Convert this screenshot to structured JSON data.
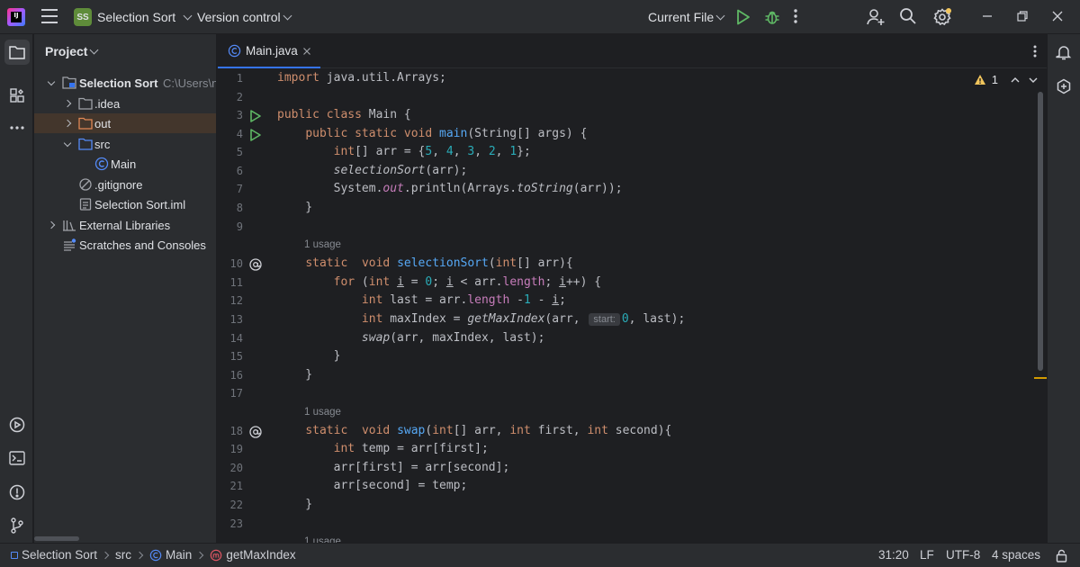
{
  "titlebar": {
    "logo_text": "IJ",
    "project_badge": "SS",
    "project_name": "Selection Sort",
    "vcs_label": "Version control",
    "run_config": "Current File"
  },
  "project_panel": {
    "title": "Project",
    "tree": [
      {
        "label": "Selection Sort",
        "path": "C:\\Users\\n",
        "icon": "module-folder-icon",
        "expanded": true,
        "bold": true
      },
      {
        "label": ".idea",
        "icon": "folder-icon",
        "expanded": false
      },
      {
        "label": "out",
        "icon": "folder-orange-icon",
        "expanded": false,
        "selected": true
      },
      {
        "label": "src",
        "icon": "source-folder-icon",
        "expanded": true
      },
      {
        "label": "Main",
        "icon": "java-class-icon"
      },
      {
        "label": ".gitignore",
        "icon": "ignored-file-icon"
      },
      {
        "label": "Selection Sort.iml",
        "icon": "iml-file-icon"
      },
      {
        "label": "External Libraries",
        "icon": "libraries-icon",
        "expanded": false
      },
      {
        "label": "Scratches and Consoles",
        "icon": "scratches-icon"
      }
    ]
  },
  "editor": {
    "tab_label": "Main.java",
    "warning_count": "1",
    "usage_label": "1 usage",
    "inlay_start": "start:",
    "line_numbers": [
      "1",
      "2",
      "3",
      "4",
      "5",
      "6",
      "7",
      "8",
      "9",
      "10",
      "11",
      "12",
      "13",
      "14",
      "15",
      "16",
      "17",
      "18",
      "19",
      "20",
      "21",
      "22",
      "23"
    ]
  },
  "statusbar": {
    "breadcrumbs": [
      "Selection Sort",
      "src",
      "Main",
      "getMaxIndex"
    ],
    "position": "31:20",
    "line_separator": "LF",
    "encoding": "UTF-8",
    "indent": "4 spaces"
  },
  "colors": {
    "accent": "#3574f0",
    "run_green": "#5fb865",
    "warning": "#f2c55c",
    "keyword": "#cf8e6d",
    "function": "#56a8f5",
    "number": "#2aacb8",
    "static_field": "#c77dbb"
  }
}
